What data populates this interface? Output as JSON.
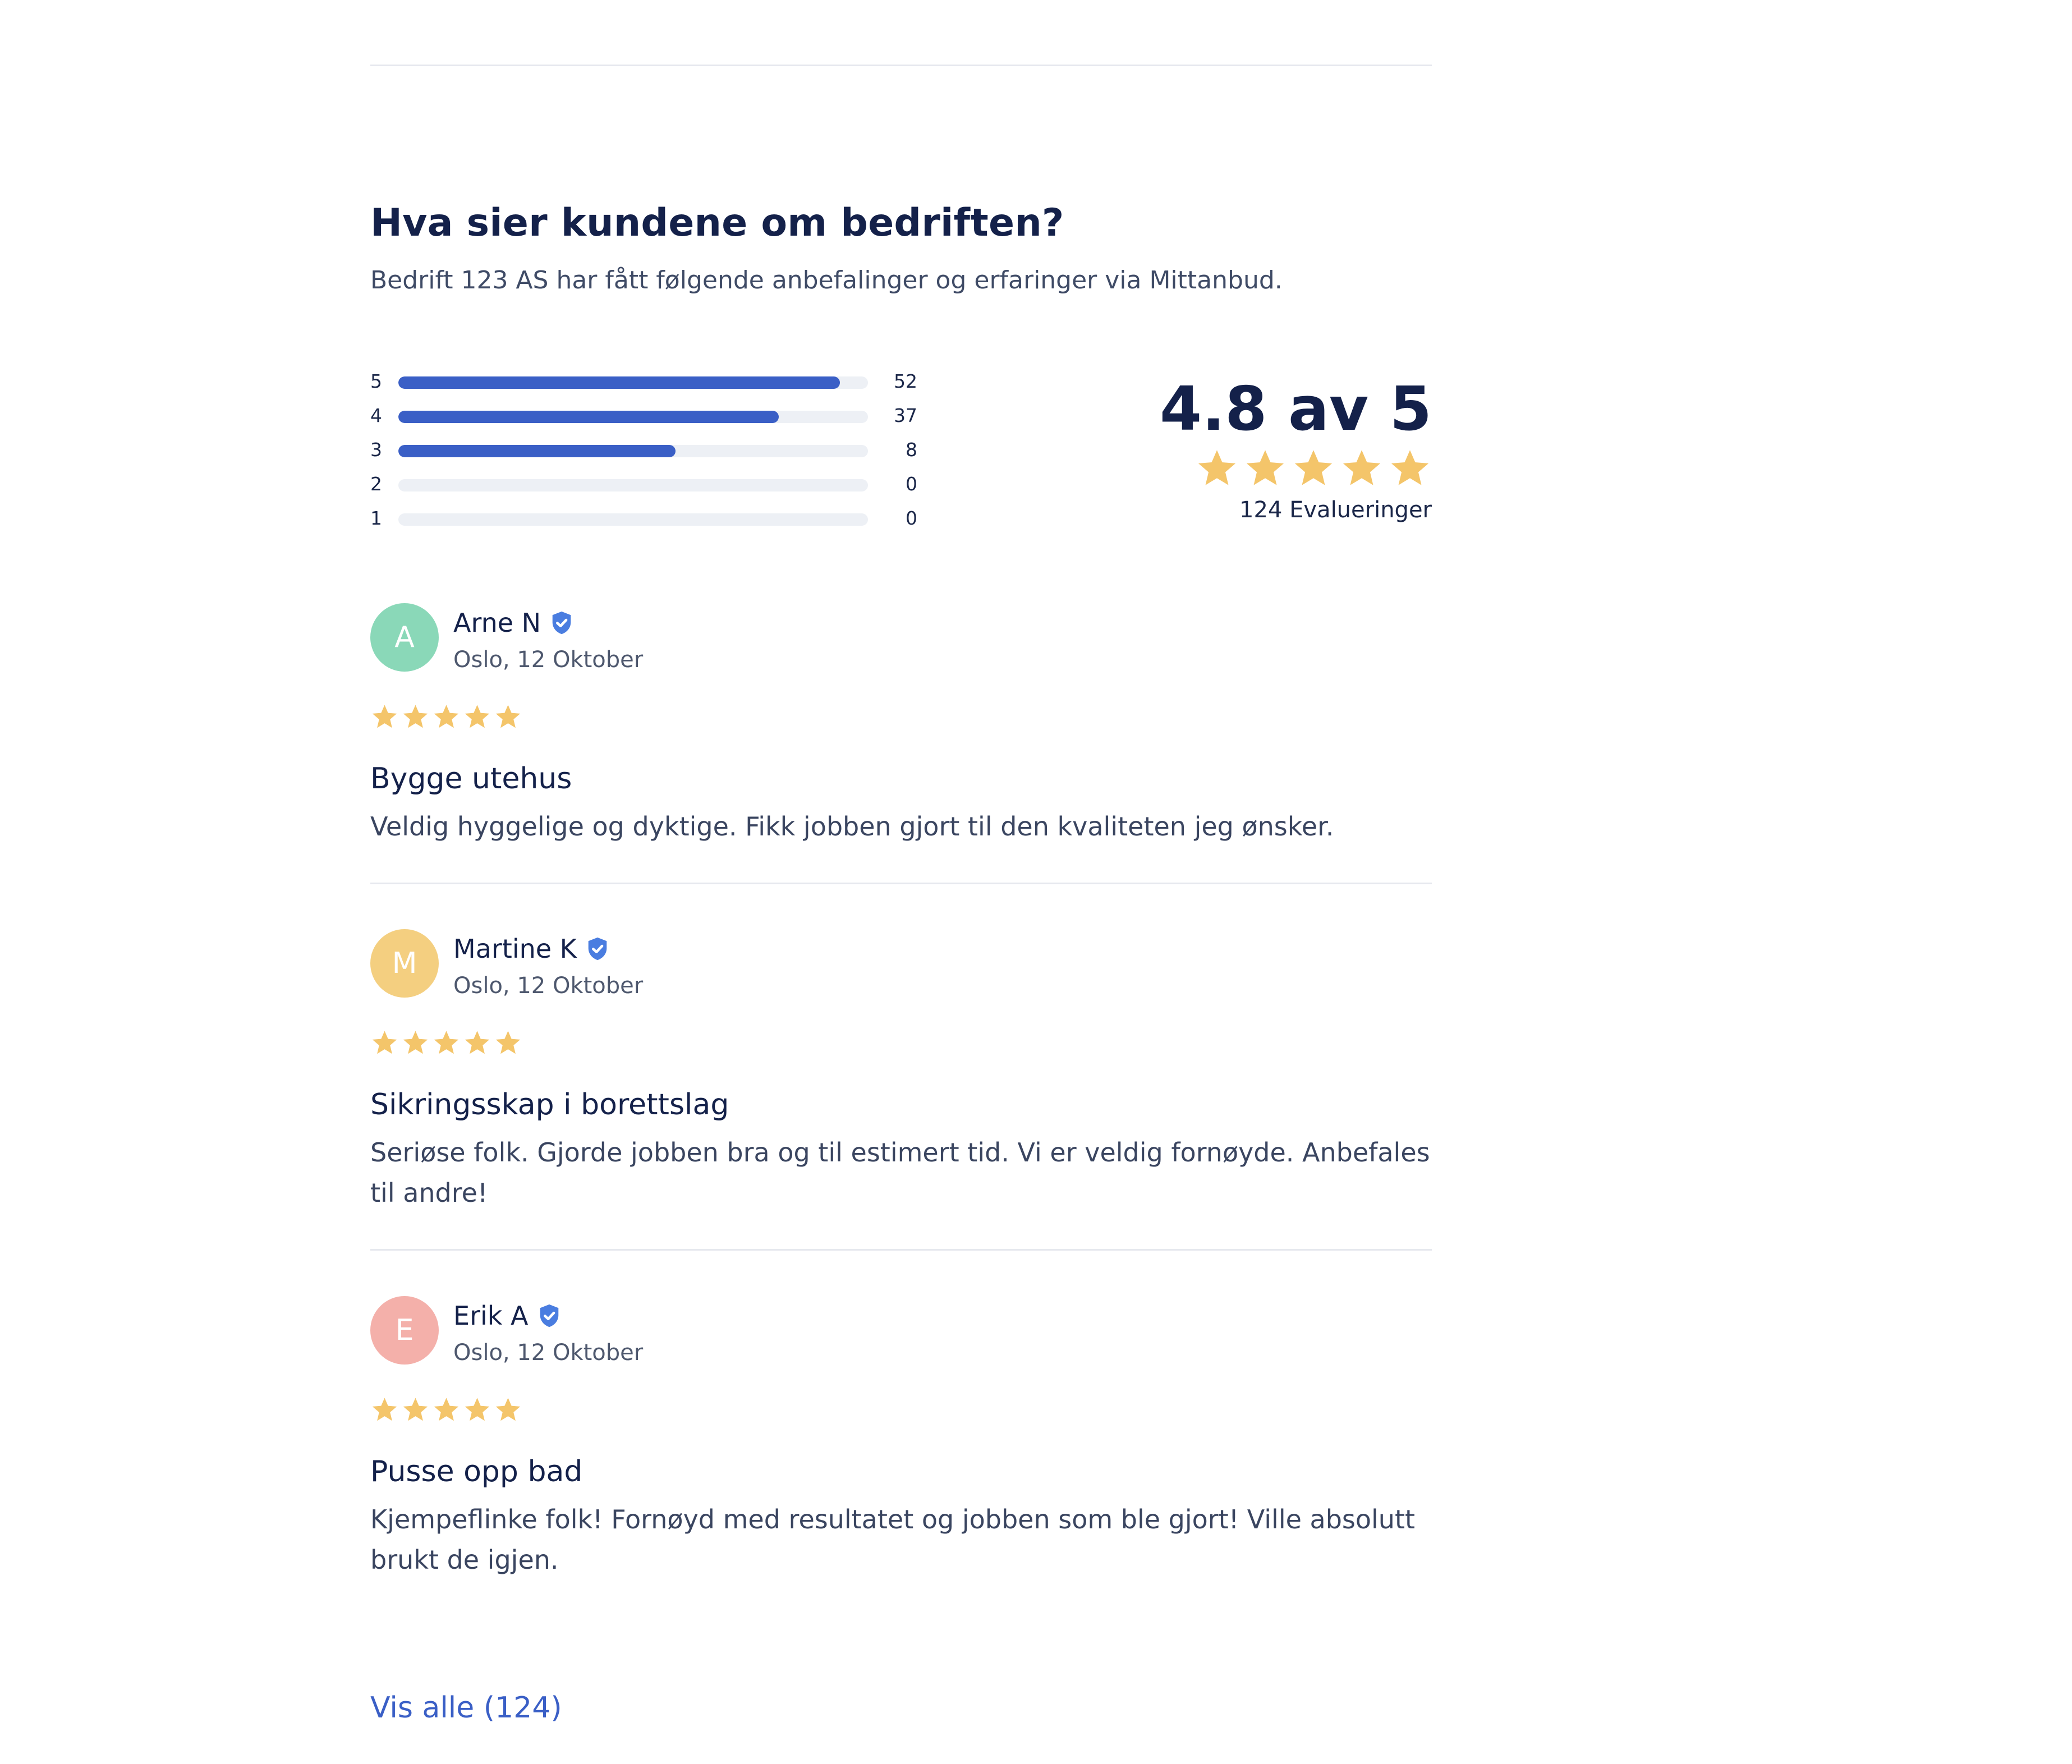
{
  "section": {
    "title": "Hva sier kundene om bedriften?",
    "subtitle": "Bedrift 123 AS har fått følgende anbefalinger og erfaringer via Mittanbud."
  },
  "rating_breakdown": [
    {
      "stars": "5",
      "count": "52",
      "fraction": 0.94
    },
    {
      "stars": "4",
      "count": "37",
      "fraction": 0.81
    },
    {
      "stars": "3",
      "count": "8",
      "fraction": 0.59
    },
    {
      "stars": "2",
      "count": "0",
      "fraction": 0
    },
    {
      "stars": "1",
      "count": "0",
      "fraction": 0
    }
  ],
  "summary": {
    "score_text": "4.8 av 5",
    "star_rating": 5,
    "count_text": "124 Evalueringer"
  },
  "reviews": [
    {
      "initial": "A",
      "avatar_color": "#8ad8b8",
      "name": "Arne N",
      "meta": "Oslo, 12 Oktober",
      "rating": 5,
      "title": "Bygge utehus",
      "body": "Veldig hyggelige og dyktige. Fikk jobben gjort til den kvaliteten jeg ønsker."
    },
    {
      "initial": "M",
      "avatar_color": "#f4cf80",
      "name": "Martine K",
      "meta": "Oslo, 12 Oktober",
      "rating": 5,
      "title": "Sikringsskap i borettslag",
      "body": "Seriøse folk. Gjorde jobben bra og til estimert tid. Vi er veldig fornøyde. Anbefales til andre!"
    },
    {
      "initial": "E",
      "avatar_color": "#f4b0aa",
      "name": "Erik A",
      "meta": "Oslo, 12 Oktober",
      "rating": 5,
      "title": "Pusse opp bad",
      "body": "Kjempeflinke folk! Fornøyd med resultatet og jobben som ble gjort! Ville absolutt brukt de igjen."
    }
  ],
  "show_all_label": "Vis alle (124)",
  "colors": {
    "accent": "#3a5fc6",
    "star": "#f4c56a",
    "verified": "#4a7de0"
  },
  "icons": {
    "star": "star-icon",
    "verified": "verified-badge-icon"
  }
}
